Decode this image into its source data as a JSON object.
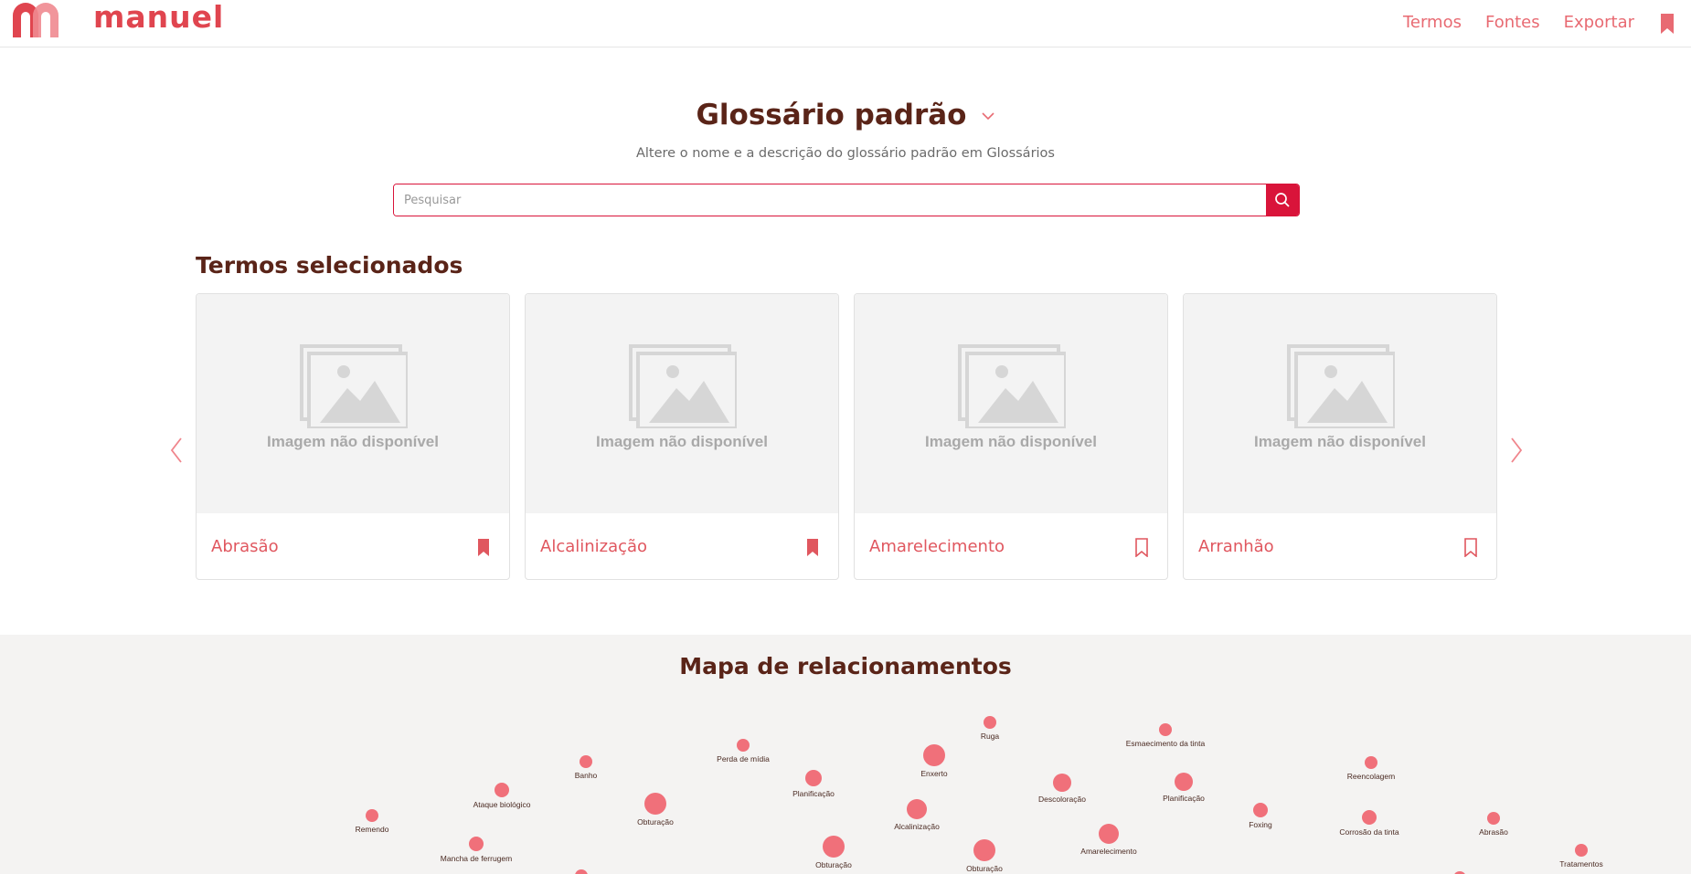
{
  "header": {
    "logo_text": "manuel",
    "nav": [
      "Termos",
      "Fontes",
      "Exportar"
    ]
  },
  "hero": {
    "title": "Glossário padrão",
    "subtitle": "Altere o nome e a descrição do glossário padrão em Glossários",
    "search_placeholder": "Pesquisar"
  },
  "selected_terms": {
    "title": "Termos selecionados",
    "unavailable_label": "Imagem não disponível",
    "cards": [
      {
        "label": "Abrasão",
        "bookmarked": true
      },
      {
        "label": "Alcalinização",
        "bookmarked": true
      },
      {
        "label": "Amarelecimento",
        "bookmarked": false
      },
      {
        "label": "Arranhão",
        "bookmarked": false
      }
    ]
  },
  "map": {
    "title": "Mapa de relacionamentos",
    "nodes": [
      "Ruga",
      "Esmaecimento da tinta",
      "Perda de mídia",
      "Enxerto",
      "Banho",
      "Reencolagem",
      "Planificação",
      "Descoloração",
      "Planificação",
      "Ataque biológico",
      "Obturação",
      "Alcalinização",
      "Foxing",
      "Corrosão da tinta",
      "Abrasão",
      "Remendo",
      "Amarelecimento",
      "Mancha de ferrugem",
      "Obturação",
      "Obturação",
      "Tratamentos"
    ]
  },
  "colors": {
    "accent": "#d9143a",
    "link": "#e86a72",
    "heading": "#5a2418",
    "node": "#f0707a"
  }
}
